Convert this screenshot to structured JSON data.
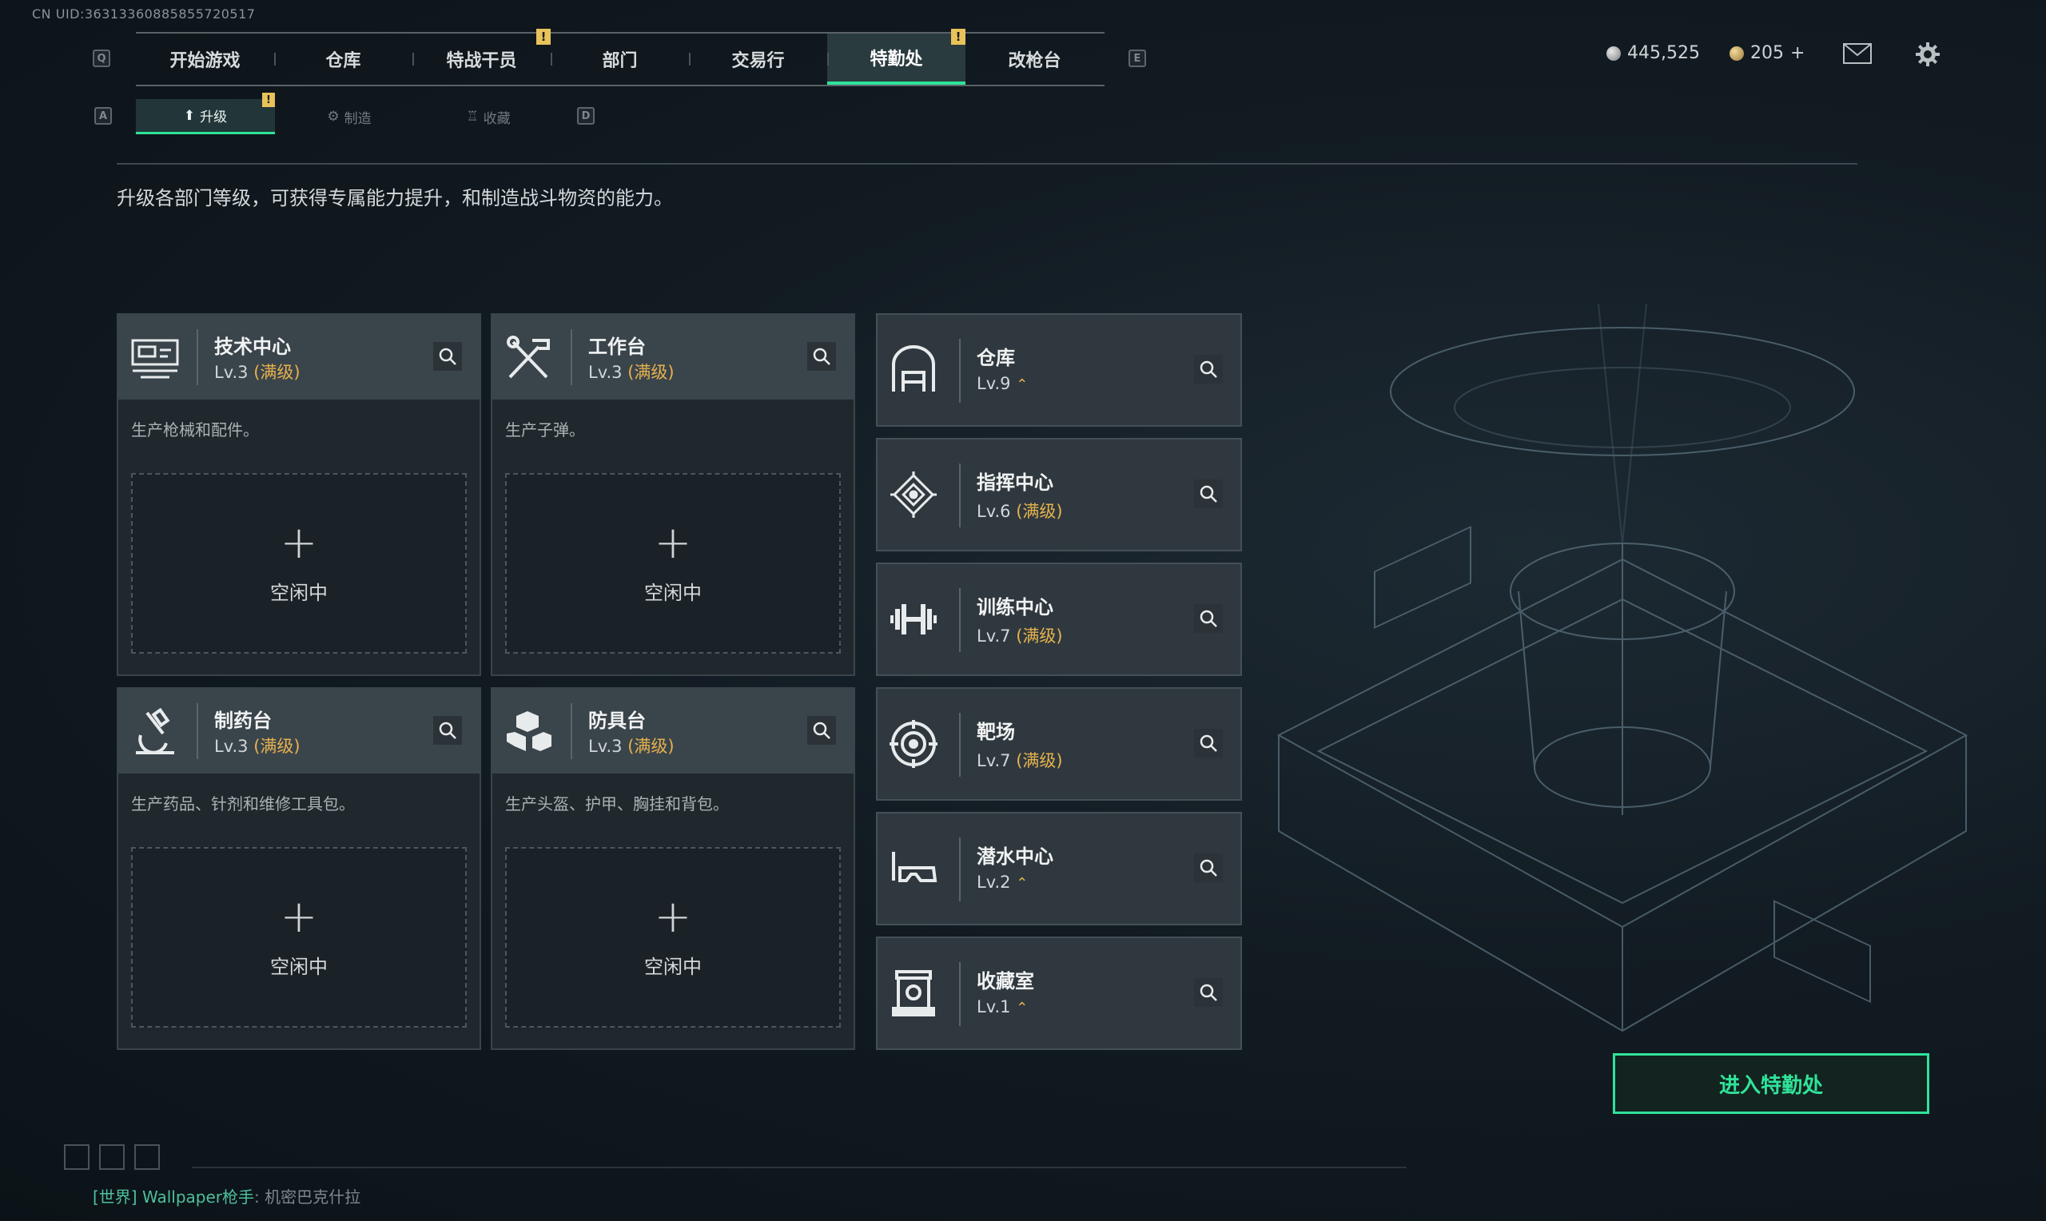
{
  "uid": "CN UID:3631336088585572051​7",
  "nav": {
    "key_left": "Q",
    "key_right": "E",
    "tabs": [
      {
        "label": "开始游戏"
      },
      {
        "label": "仓库"
      },
      {
        "label": "特战干员",
        "alert": "!"
      },
      {
        "label": "部门"
      },
      {
        "label": "交易行"
      },
      {
        "label": "特勤处",
        "alert": "!",
        "active": true
      },
      {
        "label": "改枪台"
      }
    ]
  },
  "currency": {
    "silver": "445,525",
    "gold": "205",
    "gold_plus": "+"
  },
  "subtabs": {
    "key_left": "A",
    "key_right": "D",
    "items": [
      {
        "label": "升级",
        "alert": "!",
        "active": true
      },
      {
        "label": "制造"
      },
      {
        "label": "收藏"
      }
    ]
  },
  "description": "升级各部门等级，可获得专属能力提升，和制造战斗物资的能力。",
  "production_cards": [
    {
      "name": "技术中心",
      "level": "Lv.3",
      "maxed": "(满级)",
      "desc": "生产枪械和配件。",
      "slot_plus": "+",
      "slot_label": "空闲中",
      "icon": "computer-icon"
    },
    {
      "name": "工作台",
      "level": "Lv.3",
      "maxed": "(满级)",
      "desc": "生产子弹。",
      "slot_plus": "+",
      "slot_label": "空闲中",
      "icon": "tools-icon"
    },
    {
      "name": "制药台",
      "level": "Lv.3",
      "maxed": "(满级)",
      "desc": "生产药品、针剂和维修工具包。",
      "slot_plus": "+",
      "slot_label": "空闲中",
      "icon": "microscope-icon"
    },
    {
      "name": "防具台",
      "level": "Lv.3",
      "maxed": "(满级)",
      "desc": "生产头盔、护甲、胸挂和背包。",
      "slot_plus": "+",
      "slot_label": "空闲中",
      "icon": "armor-icon"
    }
  ],
  "facility_cards": [
    {
      "name": "仓库",
      "level": "Lv.9",
      "maxed": "",
      "upgrade": "⌃",
      "icon": "warehouse-icon"
    },
    {
      "name": "指挥中心",
      "level": "Lv.6",
      "maxed": "(满级)",
      "upgrade": "",
      "icon": "command-icon"
    },
    {
      "name": "训练中心",
      "level": "Lv.7",
      "maxed": "(满级)",
      "upgrade": "",
      "icon": "dumbbell-icon"
    },
    {
      "name": "靶场",
      "level": "Lv.7",
      "maxed": "(满级)",
      "upgrade": "",
      "icon": "target-icon"
    },
    {
      "name": "潜水中心",
      "level": "Lv.2",
      "maxed": "",
      "upgrade": "⌃",
      "icon": "dive-mask-icon"
    },
    {
      "name": "收藏室",
      "level": "Lv.1",
      "maxed": "",
      "upgrade": "⌃",
      "icon": "collection-icon"
    }
  ],
  "enter_button": "进入特勤处",
  "chat": {
    "channel": "[世界]",
    "user": "Wallpaper枪手",
    "message": "机密巴克什拉"
  },
  "colors": {
    "accent": "#2fe39a",
    "maxed": "#e6b24d",
    "alert": "#e8c25a"
  }
}
